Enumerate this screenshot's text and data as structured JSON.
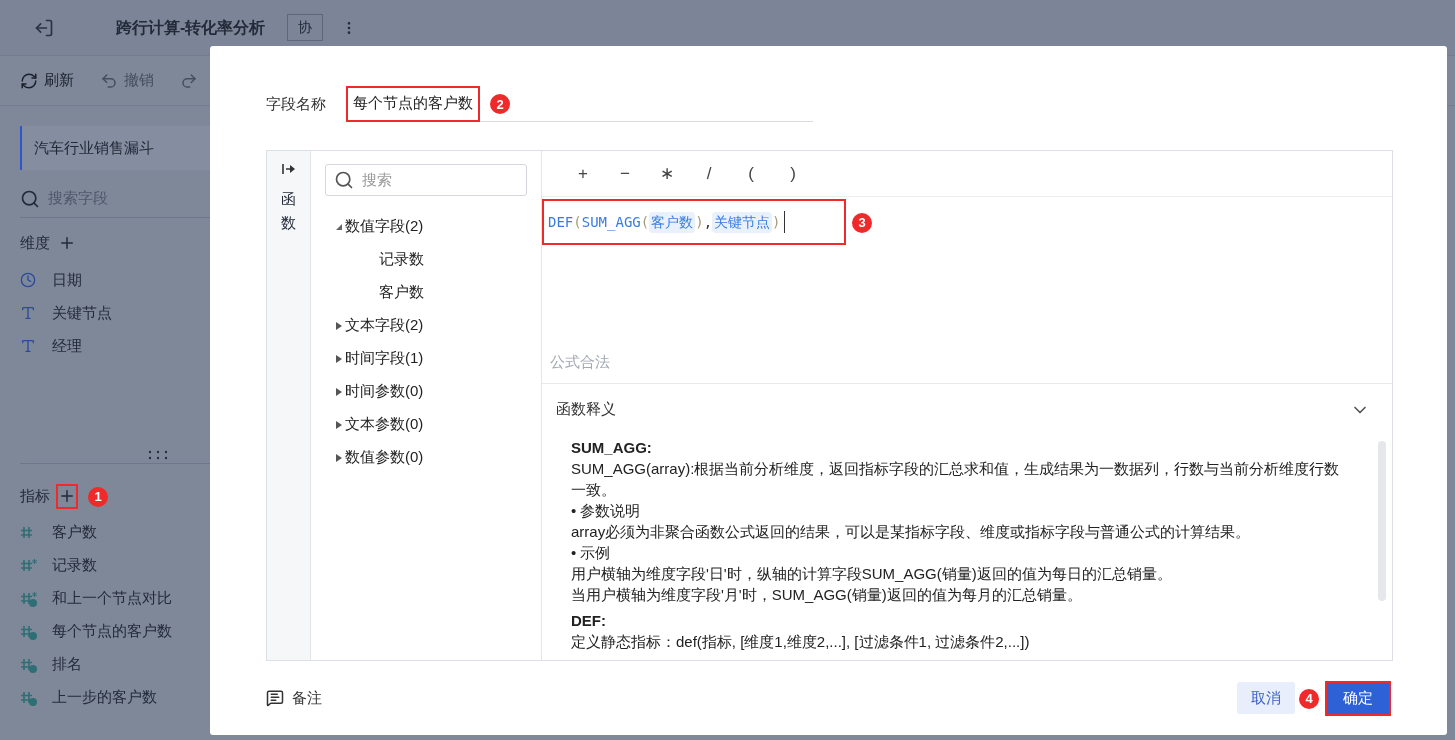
{
  "header": {
    "title": "跨行计算-转化率分析",
    "collab_badge": "协"
  },
  "toolbar": [
    {
      "kind": "refresh",
      "label": "刷新",
      "disabled": false
    },
    {
      "kind": "undo",
      "label": "撤销",
      "disabled": true
    },
    {
      "kind": "redo",
      "disabled": true
    }
  ],
  "sidebar": {
    "dataset": "汽车行业销售漏斗",
    "search": {
      "placeholder": "搜索字段"
    },
    "dimensions": {
      "title": "维度",
      "items": [
        {
          "kind": "date",
          "label": "日期"
        },
        {
          "kind": "text",
          "label": "关键节点"
        },
        {
          "kind": "text",
          "label": "经理"
        }
      ]
    },
    "metrics": {
      "title": "指标",
      "marker": "1",
      "items": [
        {
          "kind": "number",
          "label": "客户数"
        },
        {
          "kind": "number-star",
          "label": "记录数"
        },
        {
          "kind": "calc-star",
          "label": "和上一个节点对比"
        },
        {
          "kind": "calc",
          "label": "每个节点的客户数"
        },
        {
          "kind": "calc",
          "label": "排名"
        },
        {
          "kind": "calc",
          "label": "上一步的客户数"
        }
      ]
    }
  },
  "dialog": {
    "name_label": "字段名称",
    "name_value": "每个节点的客户数",
    "name_marker": "2",
    "side_tab": "函数",
    "tree": {
      "search": {
        "placeholder": "搜索"
      },
      "groups": [
        {
          "label": "数值字段(2)",
          "expanded": true,
          "children": [
            {
              "label": "记录数"
            },
            {
              "label": "客户数"
            }
          ]
        },
        {
          "label": "文本字段(2)",
          "expanded": false
        },
        {
          "label": "时间字段(1)",
          "expanded": false
        },
        {
          "label": "时间参数(0)",
          "expanded": false
        },
        {
          "label": "文本参数(0)",
          "expanded": false
        },
        {
          "label": "数值参数(0)",
          "expanded": false
        }
      ]
    },
    "operators": [
      "+",
      "−",
      "∗",
      "/",
      "(",
      ")"
    ],
    "formula": {
      "marker": "3",
      "tokens": [
        {
          "kind": "function",
          "text": "DEF"
        },
        {
          "kind": "paren",
          "text": "("
        },
        {
          "kind": "function",
          "text": "SUM_AGG"
        },
        {
          "kind": "paren",
          "text": "("
        },
        {
          "kind": "field",
          "text": "客户数"
        },
        {
          "kind": "paren",
          "text": ")"
        },
        {
          "kind": "comma",
          "text": ","
        },
        {
          "kind": "field",
          "text": "关键节点"
        },
        {
          "kind": "paren",
          "text": ")"
        }
      ]
    },
    "status": "公式合法",
    "help": {
      "title": "函数释义",
      "expanded": true,
      "lines": [
        {
          "kind": "heading",
          "text": "SUM_AGG:"
        },
        {
          "kind": "text",
          "text": "SUM_AGG(array):根据当前分析维度，返回指标字段的汇总求和值，生成结果为一数据列，行数与当前分析维度行数一致。"
        },
        {
          "kind": "text",
          "text": "• 参数说明"
        },
        {
          "kind": "text",
          "text": "array必须为非聚合函数公式返回的结果，可以是某指标字段、维度或指标字段与普通公式的计算结果。"
        },
        {
          "kind": "text",
          "text": "• 示例"
        },
        {
          "kind": "text",
          "text": "用户横轴为维度字段'日'时，纵轴的计算字段SUM_AGG(销量)返回的值为每日的汇总销量。"
        },
        {
          "kind": "text",
          "text": "当用户横轴为维度字段'月'时，SUM_AGG(销量)返回的值为每月的汇总销量。"
        },
        {
          "kind": "heading",
          "text": "DEF:"
        },
        {
          "kind": "text",
          "text": "定义静态指标：def(指标, [维度1,维度2,...], [过滤条件1, 过滤条件2,...])"
        }
      ]
    },
    "note": "备注",
    "cancel": "取消",
    "confirm": "确定",
    "confirm_marker": "4"
  }
}
